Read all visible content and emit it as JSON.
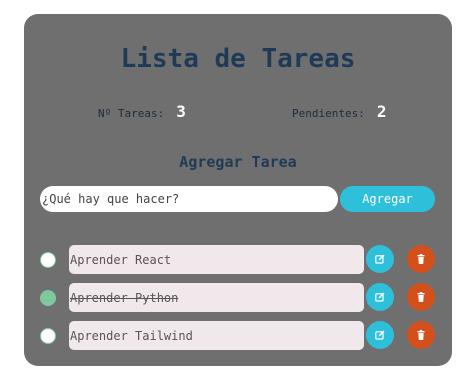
{
  "header": {
    "title": "Lista de Tareas"
  },
  "stats": {
    "total_label": "Nº Tareas:",
    "total_value": "3",
    "pending_label": "Pendientes:",
    "pending_value": "2"
  },
  "add_section": {
    "title": "Agregar Tarea",
    "input_placeholder": "¿Qué hay que hacer?",
    "input_value": "",
    "button_label": "Agregar"
  },
  "tasks": [
    {
      "text": "Aprender React",
      "completed": false
    },
    {
      "text": "Aprender Python",
      "completed": true
    },
    {
      "text": "Aprender Tailwind",
      "completed": false
    }
  ],
  "icons": {
    "edit": "edit-icon",
    "delete": "trash-icon"
  },
  "colors": {
    "card_bg": "#706f70",
    "accent": "#2ec0da",
    "delete": "#d3501d",
    "check": "#7fc89b",
    "title": "#1f3a57"
  }
}
